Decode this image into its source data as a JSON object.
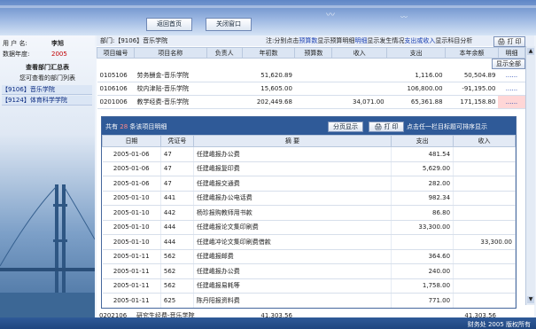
{
  "header": {
    "back_button": "返回首页",
    "close_button": "关闭窗口"
  },
  "left": {
    "user_label": "用 户 名:",
    "user_value": "李旭",
    "year_label": "数据年度:",
    "year_value": "2005",
    "summary_title": "查看部门汇总表",
    "dept_list_title": "您可查看的部门列表",
    "depts": [
      "【9106】音乐学院",
      "【9124】体育科学学院"
    ]
  },
  "main": {
    "dept_line": "部门:【9106】音乐学院",
    "note_prefix": "注:分别点击",
    "note_link1": "预算数",
    "note_mid1": "显示预算明细",
    "note_link2": "明细",
    "note_mid2": "显示发生情况",
    "note_link3": "支出或收入",
    "note_suffix": "显示科目分析",
    "print_button": "打 印",
    "show_all_button": "显示全部",
    "columns": [
      "项目编号",
      "项目名称",
      "负责人",
      "年初数",
      "预算数",
      "收入",
      "支出",
      "本年余额",
      "明细"
    ],
    "rows": [
      {
        "code": "0105106",
        "name": "劳务酬金-音乐学院",
        "owner": "",
        "begin": "51,620.89",
        "budget": "",
        "income": "",
        "expense": "1,116.00",
        "balance": "50,504.89",
        "detail": "......"
      },
      {
        "code": "0106106",
        "name": "校内津贴-音乐学院",
        "owner": "",
        "begin": "15,605.00",
        "budget": "",
        "income": "",
        "expense": "106,800.00",
        "balance": "-91,195.00",
        "detail": "......"
      },
      {
        "code": "0201006",
        "name": "教学经费-音乐学院",
        "owner": "",
        "begin": "202,449.68",
        "budget": "",
        "income": "34,071.00",
        "expense": "65,361.88",
        "balance": "171,158.80",
        "detail": "......"
      }
    ],
    "last_row": {
      "code": "0202106",
      "name": "研究生经费-音乐学院",
      "begin": "41,303.56",
      "balance": "41,303.56"
    }
  },
  "popup": {
    "count_prefix": "共有",
    "count_value": "28",
    "count_suffix": "条该项目明细",
    "page_button": "分页显示",
    "print_button": "打 印",
    "sort_hint": "点击任一栏目标题可排序显示",
    "columns": [
      "日期",
      "凭证号",
      "摘 要",
      "支出",
      "收入"
    ],
    "rows": [
      {
        "date": "2005-01-06",
        "voucher": "47",
        "summary": "任建峨报办公费",
        "expense": "481.54",
        "income": ""
      },
      {
        "date": "2005-01-06",
        "voucher": "47",
        "summary": "任建峨报复印费",
        "expense": "5,629.00",
        "income": ""
      },
      {
        "date": "2005-01-06",
        "voucher": "47",
        "summary": "任建峨报交通费",
        "expense": "282.00",
        "income": ""
      },
      {
        "date": "2005-01-10",
        "voucher": "441",
        "summary": "任建峨报办公电话费",
        "expense": "982.34",
        "income": ""
      },
      {
        "date": "2005-01-10",
        "voucher": "442",
        "summary": "杨珍报购教师用书款",
        "expense": "86.80",
        "income": ""
      },
      {
        "date": "2005-01-10",
        "voucher": "444",
        "summary": "任建峨报论文集印刷费",
        "expense": "33,300.00",
        "income": ""
      },
      {
        "date": "2005-01-10",
        "voucher": "444",
        "summary": "任建峨冲论文集印刷费借款",
        "expense": "",
        "income": "33,300.00"
      },
      {
        "date": "2005-01-11",
        "voucher": "562",
        "summary": "任建峨报邮费",
        "expense": "364.60",
        "income": ""
      },
      {
        "date": "2005-01-11",
        "voucher": "562",
        "summary": "任建峨报办公费",
        "expense": "240.00",
        "income": ""
      },
      {
        "date": "2005-01-11",
        "voucher": "562",
        "summary": "任建峨报易耗等",
        "expense": "1,758.00",
        "income": ""
      },
      {
        "date": "2005-01-11",
        "voucher": "625",
        "summary": "陈丹阳报资料费",
        "expense": "771.00",
        "income": ""
      }
    ]
  },
  "footer": {
    "text": "财务处 2005 版权所有"
  }
}
